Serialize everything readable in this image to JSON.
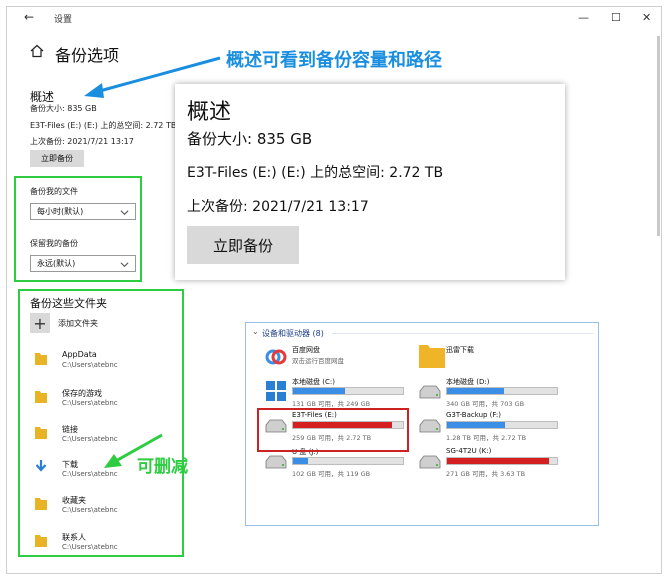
{
  "window": {
    "title": "设置",
    "back_glyph": "←",
    "minimize_glyph": "—",
    "maximize_glyph": "☐",
    "close_glyph": "✕"
  },
  "page": {
    "title": "备份选项"
  },
  "overview": {
    "heading": "概述",
    "backup_size": "备份大小: 835 GB",
    "total_space": "E3T-Files (E:) (E:) 上的总空间: 2.72 TB",
    "last_backup": "上次备份: 2021/7/21 13:17",
    "backup_now": "立即备份"
  },
  "overview_zoom": {
    "heading": "概述",
    "backup_size": "备份大小: 835 GB",
    "total_space": "E3T-Files (E:) (E:) 上的总空间: 2.72 TB",
    "last_backup": "上次备份: 2021/7/21 13:17",
    "backup_now": "立即备份"
  },
  "frequency": {
    "label": "备份我的文件",
    "selected": "每小时(默认)"
  },
  "retention": {
    "label": "保留我的备份",
    "selected": "永远(默认)"
  },
  "folders": {
    "title": "备份这些文件夹",
    "add_label": "添加文件夹",
    "add_glyph": "+",
    "items": [
      {
        "name": "AppData",
        "path": "C:\\Users\\atebnc"
      },
      {
        "name": "保存的游戏",
        "path": "C:\\Users\\atebnc"
      },
      {
        "name": "链接",
        "path": "C:\\Users\\atebnc"
      },
      {
        "name": "下载",
        "path": "C:\\Users\\atebnc"
      },
      {
        "name": "收藏夹",
        "path": "C:\\Users\\atebnc"
      },
      {
        "name": "联系人",
        "path": "C:\\Users\\atebnc"
      }
    ]
  },
  "annotations": {
    "overview_note": "概述可看到备份容量和路径",
    "delete_note": "可删减"
  },
  "devices_panel": {
    "header": "设备和驱动器 (8)",
    "collapse_glyph": "⌄",
    "devices": [
      {
        "name": "百度网盘",
        "sub": "双击运行百度网盘",
        "fill": null,
        "color": "#3a8ee6",
        "kind": "app"
      },
      {
        "name": "迅雷下载",
        "sub": "",
        "fill": null,
        "color": "#f0b429",
        "kind": "folder"
      },
      {
        "name": "本地磁盘 (C:)",
        "sub": "131 GB 可用，共 249 GB",
        "fill": 0.47,
        "color": "#3a8ee6",
        "kind": "windows"
      },
      {
        "name": "本地磁盘 (D:)",
        "sub": "340 GB 可用，共 703 GB",
        "fill": 0.52,
        "color": "#3a8ee6",
        "kind": "drive"
      },
      {
        "name": "E3T-Files (E:)",
        "sub": "259 GB 可用，共 2.72 TB",
        "fill": 0.9,
        "color": "#d42020",
        "kind": "drive"
      },
      {
        "name": "G3T-Backup (F:)",
        "sub": "1.28 TB 可用，共 2.72 TB",
        "fill": 0.53,
        "color": "#3a8ee6",
        "kind": "drive"
      },
      {
        "name": "U 盘 (J:)",
        "sub": "102 GB 可用，共 119 GB",
        "fill": 0.14,
        "color": "#3a8ee6",
        "kind": "drive"
      },
      {
        "name": "SG-4T2U (K:)",
        "sub": "271 GB 可用，共 3.63 TB",
        "fill": 0.93,
        "color": "#d42020",
        "kind": "drive"
      }
    ]
  }
}
